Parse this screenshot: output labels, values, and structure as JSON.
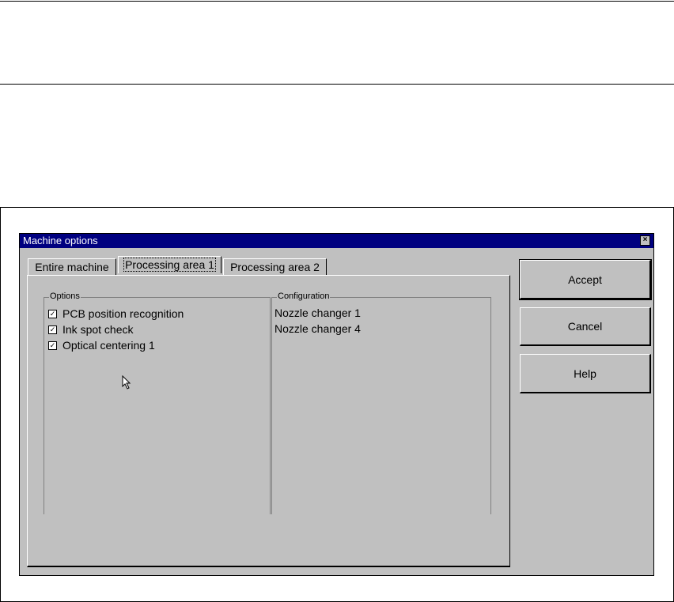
{
  "dialog": {
    "title": "Machine options",
    "close_glyph": "×"
  },
  "tabs": [
    {
      "label": "Entire machine"
    },
    {
      "label": "Processing area 1",
      "active": true
    },
    {
      "label": "Processing area 2"
    }
  ],
  "options_group": {
    "label": "Options",
    "items": [
      {
        "label": "PCB position recognition",
        "checked": true
      },
      {
        "label": "Ink spot check",
        "checked": true
      },
      {
        "label": "Optical centering 1",
        "checked": true
      }
    ],
    "check_glyph": "✓"
  },
  "configuration_group": {
    "label": "Configuration",
    "items": [
      "Nozzle changer 1",
      "Nozzle changer 4"
    ]
  },
  "buttons": {
    "accept": "Accept",
    "cancel": "Cancel",
    "help": "Help"
  }
}
